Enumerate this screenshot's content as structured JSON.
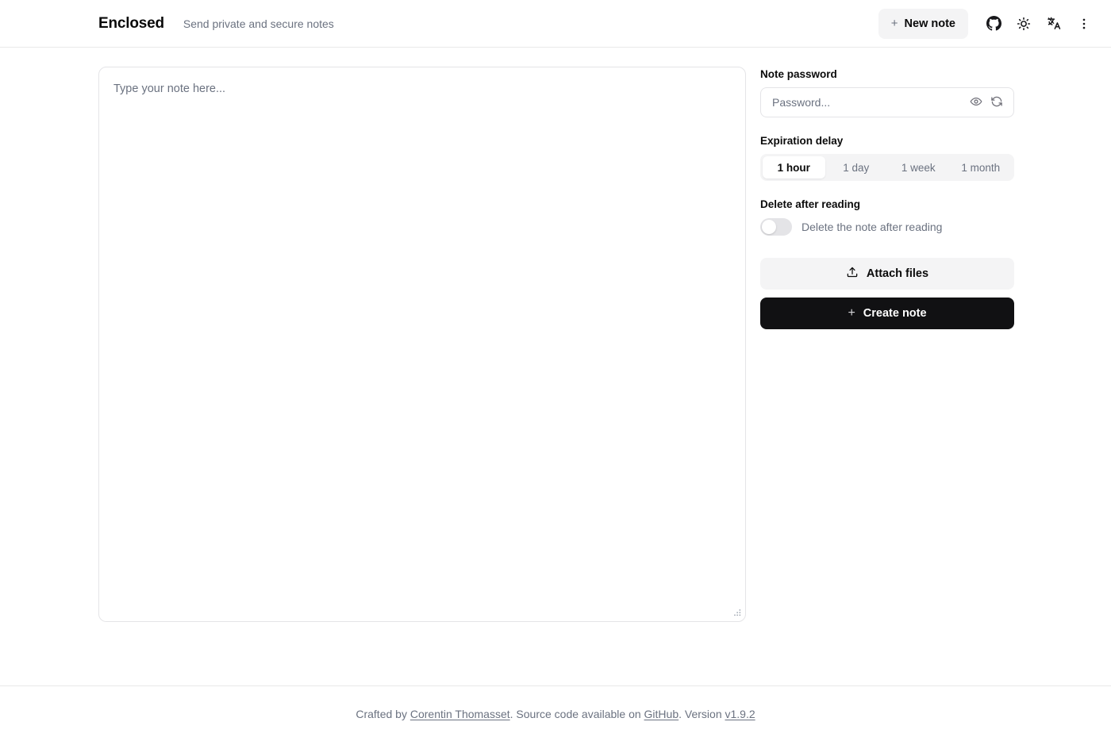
{
  "header": {
    "brand_title": "Enclosed",
    "tagline": "Send private and secure notes",
    "new_note_label": "New note",
    "new_note_plus": "+",
    "icons": {
      "github": "github-icon",
      "theme": "sun-icon",
      "language": "translate-icon",
      "more": "kebab-menu-icon"
    }
  },
  "editor": {
    "placeholder": "Type your note here...",
    "value": ""
  },
  "panel": {
    "password_label": "Note password",
    "password_placeholder": "Password...",
    "password_value": "",
    "expiration_label": "Expiration delay",
    "expiration_options": [
      {
        "label": "1 hour",
        "selected": true
      },
      {
        "label": "1 day",
        "selected": false
      },
      {
        "label": "1 week",
        "selected": false
      },
      {
        "label": "1 month",
        "selected": false
      }
    ],
    "delete_after_reading_label": "Delete after reading",
    "delete_toggle_label": "Delete the note after reading",
    "delete_toggle_state": "off",
    "attach_files_label": "Attach files",
    "create_note_label": "Create note",
    "create_note_plus": "+"
  },
  "footer": {
    "prefix": "Crafted by ",
    "author": "Corentin Thomasset",
    "middle": ". Source code available on ",
    "source_link": "GitHub",
    "version_prefix": ". Version ",
    "version": "v1.9.2"
  },
  "colors": {
    "accent_dark": "#111113",
    "muted_bg": "#f4f4f5",
    "border": "#e4e4e7",
    "text_muted": "#6b7280"
  }
}
